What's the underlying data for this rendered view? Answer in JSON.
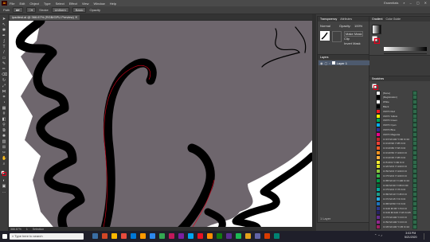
{
  "menubar": {
    "items": [
      "File",
      "Edit",
      "Object",
      "Type",
      "Select",
      "Effect",
      "View",
      "Window",
      "Help"
    ],
    "app_logo": "Ai",
    "workspace": "Essentials",
    "search_placeholder": "Search"
  },
  "control_bar": {
    "selection": "Path",
    "stroke": "Stroke",
    "uniform": "Uniform",
    "basic": "Basic",
    "opacity_label": "Opacity"
  },
  "document": {
    "tab_title": "ipadtest.ai @ 366.67% (RGB/GPU Preview)"
  },
  "status": {
    "zoom": "366.67%",
    "artboard": "1",
    "tool": "Selection"
  },
  "panels": {
    "transparency": {
      "tabs": [
        "Transparency",
        "Attributes"
      ],
      "blend": "Normal",
      "opacity_label": "Opacity:",
      "opacity": "100%",
      "make_mask": "Make Mask",
      "clip": "Clip",
      "invert": "Invert Mask"
    },
    "gradient": {
      "tabs": [
        "Gradient",
        "Color Guide"
      ]
    },
    "layers": {
      "tabs": [
        "Layers"
      ],
      "layer_name": "Layer 1",
      "count": "1 Layer"
    },
    "swatches": {
      "tabs": [
        "Swatches"
      ],
      "items": [
        {
          "name": "[None]",
          "color": "#ffffff"
        },
        {
          "name": "[Registration]",
          "color": "#000000"
        },
        {
          "name": "White",
          "color": "#ffffff"
        },
        {
          "name": "Black",
          "color": "#000000"
        },
        {
          "name": "CMYK Red",
          "color": "#ed1c24"
        },
        {
          "name": "CMYK Yellow",
          "color": "#fff200"
        },
        {
          "name": "CMYK Green",
          "color": "#00a651"
        },
        {
          "name": "CMYK Cyan",
          "color": "#00aeef"
        },
        {
          "name": "CMYK Blue",
          "color": "#2e3192"
        },
        {
          "name": "CMYK Magenta",
          "color": "#ec008c"
        },
        {
          "name": "C=15 M=100 Y=90 K=10",
          "color": "#c1272d"
        },
        {
          "name": "C=0 M=90 Y=85 K=0",
          "color": "#ee4036"
        },
        {
          "name": "C=0 M=80 Y=95 K=0",
          "color": "#f05a28"
        },
        {
          "name": "C=0 M=50 Y=100 K=0",
          "color": "#f7931e"
        },
        {
          "name": "C=0 M=35 Y=85 K=0",
          "color": "#fbb040"
        },
        {
          "name": "C=5 M=0 Y=90 K=0",
          "color": "#f9ed32"
        },
        {
          "name": "C=20 M=0 Y=100 K=0",
          "color": "#d7df23"
        },
        {
          "name": "C=50 M=0 Y=100 K=0",
          "color": "#8dc63f"
        },
        {
          "name": "C=75 M=0 Y=100 K=0",
          "color": "#39b54a"
        },
        {
          "name": "C=85 M=10 Y=100 K=10",
          "color": "#009444"
        },
        {
          "name": "C=90 M=30 Y=95 K=30",
          "color": "#006838"
        },
        {
          "name": "C=75 M=0 Y=75 K=0",
          "color": "#00a79d"
        },
        {
          "name": "C=80 M=10 Y=45 K=0",
          "color": "#1b9e8b"
        },
        {
          "name": "C=70 M=15 Y=0 K=0",
          "color": "#27aae1"
        },
        {
          "name": "C=85 M=50 Y=0 K=0",
          "color": "#1c75bc"
        },
        {
          "name": "C=100 M=95 Y=5 K=0",
          "color": "#2b3990"
        },
        {
          "name": "C=100 M=100 Y=25 K=25",
          "color": "#262262"
        },
        {
          "name": "C=75 M=100 Y=0 K=0",
          "color": "#662d91"
        },
        {
          "name": "C=50 M=100 Y=0 K=0",
          "color": "#92278f"
        },
        {
          "name": "C=35 M=100 Y=35 K=10",
          "color": "#9e1f63"
        }
      ]
    }
  },
  "taskbar": {
    "time": "3:03 PM",
    "date": "5/21/2020"
  },
  "colors": {
    "canvas_fill": "#6e666d",
    "stroke": "#000000",
    "path_highlight": "#e0001b"
  }
}
